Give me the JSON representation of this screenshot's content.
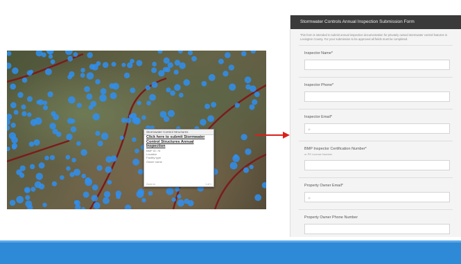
{
  "popup": {
    "title": "Stormwater Control Structures",
    "link_text": "Click here to submit Stormwater Control Structures Annual Inspection",
    "fields": [
      "BMP ID: 76",
      "Location",
      "Facility type",
      "Owner name"
    ],
    "footer_left": "Zoom to",
    "footer_right": "1 of 1"
  },
  "form": {
    "title": "Stormwater Controls Annual Inspection Submission Form",
    "description": "This form is intended to submit annual inspection documentation for privately owned stormwater control features in Lexington County. For your submission to be approved all fields must be completed.",
    "fields": [
      {
        "label": "Inspector Name*",
        "hint": "",
        "placeholder": ""
      },
      {
        "label": "Inspector Phone*",
        "hint": "",
        "placeholder": ""
      },
      {
        "label": "Inspector Email*",
        "hint": "",
        "placeholder": "@"
      },
      {
        "label": "BMP Inspector Certification Number*",
        "hint": "or PE License Number",
        "placeholder": ""
      },
      {
        "label": "Property Owner Email*",
        "hint": "",
        "placeholder": "@"
      },
      {
        "label": "Property Owner Phone Number",
        "hint": "",
        "placeholder": ""
      }
    ]
  },
  "colors": {
    "accent": "#2e8ad6",
    "arrow": "#d9201c",
    "map_point": "#2f8ff0"
  }
}
